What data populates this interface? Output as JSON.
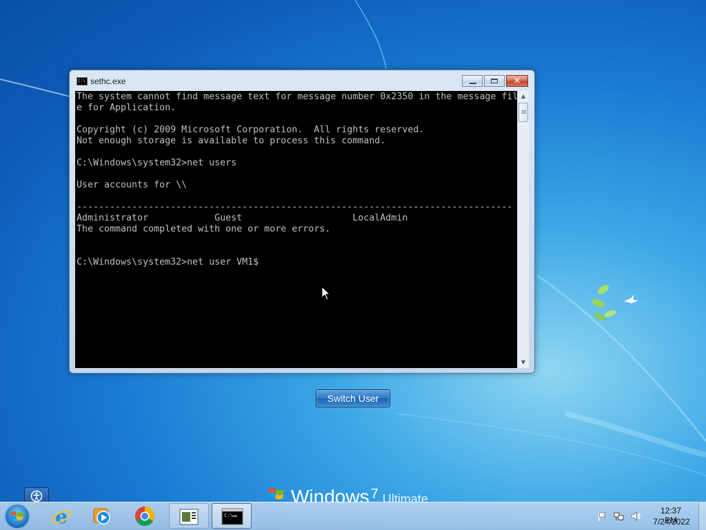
{
  "window": {
    "title": "sethc.exe",
    "close_glyph": "✕",
    "icon_text": "C:\\"
  },
  "console": {
    "lines": [
      "The system cannot find message text for message number 0x2350 in the message fil",
      "e for Application.",
      "",
      "Copyright (c) 2009 Microsoft Corporation.  All rights reserved.",
      "Not enough storage is available to process this command.",
      "",
      "C:\\Windows\\system32>net users",
      "",
      "User accounts for \\\\",
      "",
      "-------------------------------------------------------------------------------",
      "Administrator            Guest                    LocalAdmin",
      "The command completed with one or more errors.",
      "",
      "",
      "C:\\Windows\\system32>net user VM1$"
    ]
  },
  "logon": {
    "switch_user_label": "Switch User"
  },
  "branding": {
    "main": "Windows",
    "version": "7",
    "edition": "Ultimate"
  },
  "taskbar": {
    "items": [
      {
        "name": "internet-explorer-icon"
      },
      {
        "name": "windows-media-player-icon"
      },
      {
        "name": "chrome-icon"
      },
      {
        "name": "remote-desktop-icon"
      },
      {
        "name": "command-prompt-icon"
      }
    ],
    "tray_icons": [
      "action-center-flag-icon",
      "network-icon",
      "volume-icon"
    ],
    "clock": {
      "time": "12:37 PM",
      "date": "7/24/2022"
    }
  },
  "colors": {
    "console_bg": "#000000",
    "console_fg": "#c0c0c0",
    "desktop_blue": "#1a7bd3"
  }
}
